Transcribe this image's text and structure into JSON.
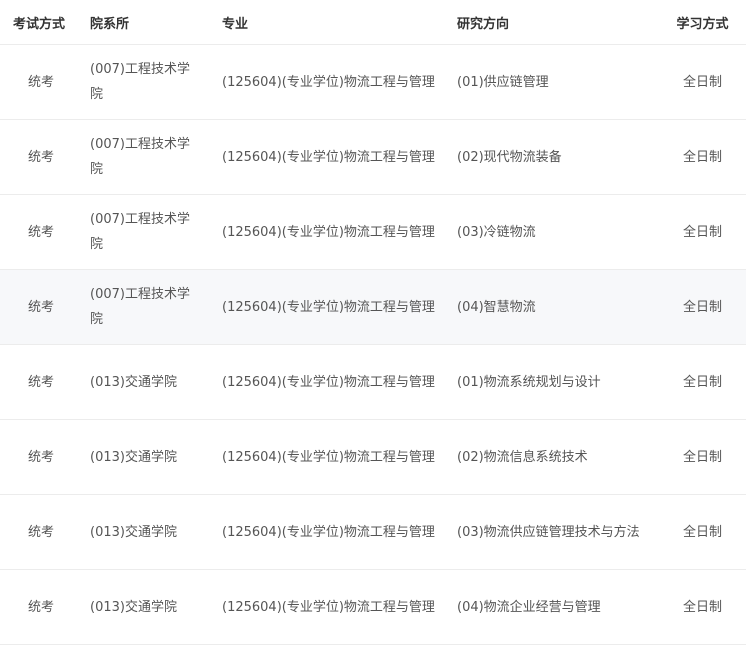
{
  "headers": {
    "exam_mode": "考试方式",
    "department": "院系所",
    "major": "专业",
    "direction": "研究方向",
    "study_mode": "学习方式"
  },
  "rows": [
    {
      "exam_mode": "统考",
      "department": "(007)工程技术学院",
      "major": "(125604)(专业学位)物流工程与管理",
      "direction": "(01)供应链管理",
      "study_mode": "全日制"
    },
    {
      "exam_mode": "统考",
      "department": "(007)工程技术学院",
      "major": "(125604)(专业学位)物流工程与管理",
      "direction": "(02)现代物流装备",
      "study_mode": "全日制"
    },
    {
      "exam_mode": "统考",
      "department": "(007)工程技术学院",
      "major": "(125604)(专业学位)物流工程与管理",
      "direction": "(03)冷链物流",
      "study_mode": "全日制"
    },
    {
      "exam_mode": "统考",
      "department": "(007)工程技术学院",
      "major": "(125604)(专业学位)物流工程与管理",
      "direction": "(04)智慧物流",
      "study_mode": "全日制"
    },
    {
      "exam_mode": "统考",
      "department": "(013)交通学院",
      "major": "(125604)(专业学位)物流工程与管理",
      "direction": "(01)物流系统规划与设计",
      "study_mode": "全日制"
    },
    {
      "exam_mode": "统考",
      "department": "(013)交通学院",
      "major": "(125604)(专业学位)物流工程与管理",
      "direction": "(02)物流信息系统技术",
      "study_mode": "全日制"
    },
    {
      "exam_mode": "统考",
      "department": "(013)交通学院",
      "major": "(125604)(专业学位)物流工程与管理",
      "direction": "(03)物流供应链管理技术与方法",
      "study_mode": "全日制"
    },
    {
      "exam_mode": "统考",
      "department": "(013)交通学院",
      "major": "(125604)(专业学位)物流工程与管理",
      "direction": "(04)物流企业经营与管理",
      "study_mode": "全日制"
    }
  ]
}
